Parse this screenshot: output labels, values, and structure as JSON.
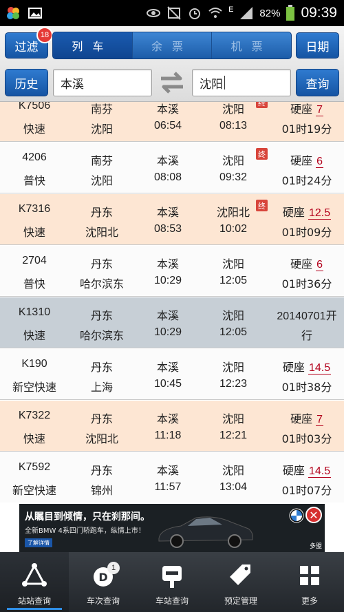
{
  "status_bar": {
    "network": "E",
    "battery": "82%",
    "time": "09:39"
  },
  "toolbar": {
    "filter_label": "过滤",
    "filter_badge": "18",
    "tabs": [
      {
        "label": "列车",
        "active": true
      },
      {
        "label": "余票",
        "active": false
      },
      {
        "label": "机票",
        "active": false
      }
    ],
    "date_label": "日期",
    "history_label": "历史",
    "from_value": "本溪",
    "to_value": "沈阳",
    "query_label": "查询"
  },
  "trains": [
    {
      "number": "K7506",
      "type": "快速",
      "origin": "南芬",
      "destination": "沈阳",
      "board": "本溪",
      "alight": "沈阳",
      "depart": "06:54",
      "arrive": "08:13",
      "terminal": "终",
      "seat": "硬座",
      "price": "7",
      "duration": "01时19分",
      "color": "orange"
    },
    {
      "number": "4206",
      "type": "普快",
      "origin": "南芬",
      "destination": "沈阳",
      "board": "本溪",
      "alight": "沈阳",
      "depart": "08:08",
      "arrive": "09:32",
      "terminal": "终",
      "seat": "硬座",
      "price": "6",
      "duration": "01时24分",
      "color": "white"
    },
    {
      "number": "K7316",
      "type": "快速",
      "origin": "丹东",
      "destination": "沈阳北",
      "board": "本溪",
      "alight": "沈阳北",
      "depart": "08:53",
      "arrive": "10:02",
      "terminal": "终",
      "seat": "硬座",
      "price": "12.5",
      "duration": "01时09分",
      "color": "orange"
    },
    {
      "number": "2704",
      "type": "普快",
      "origin": "丹东",
      "destination": "哈尔滨东",
      "board": "本溪",
      "alight": "沈阳",
      "depart": "10:29",
      "arrive": "12:05",
      "terminal": "",
      "seat": "硬座",
      "price": "6",
      "duration": "01时36分",
      "color": "white"
    },
    {
      "number": "K1310",
      "type": "快速",
      "origin": "丹东",
      "destination": "哈尔滨东",
      "board": "本溪",
      "alight": "沈阳",
      "depart": "10:29",
      "arrive": "12:05",
      "terminal": "",
      "open_date": "20140701开",
      "open_suffix": "行",
      "color": "gray"
    },
    {
      "number": "K190",
      "type": "新空快速",
      "origin": "丹东",
      "destination": "上海",
      "board": "本溪",
      "alight": "沈阳",
      "depart": "10:45",
      "arrive": "12:23",
      "terminal": "",
      "seat": "硬座",
      "price": "14.5",
      "duration": "01时38分",
      "color": "white"
    },
    {
      "number": "K7322",
      "type": "快速",
      "origin": "丹东",
      "destination": "沈阳北",
      "board": "本溪",
      "alight": "沈阳",
      "depart": "11:18",
      "arrive": "12:21",
      "terminal": "",
      "seat": "硬座",
      "price": "7",
      "duration": "01时03分",
      "color": "orange"
    },
    {
      "number": "K7592",
      "type": "新空快速",
      "origin": "丹东",
      "destination": "锦州",
      "board": "本溪",
      "alight": "沈阳",
      "depart": "11:57",
      "arrive": "13:04",
      "terminal": "",
      "seat": "硬座",
      "price": "14.5",
      "duration": "01时07分",
      "color": "white"
    }
  ],
  "ad": {
    "title": "从瞩目到倾情，只在刹那间。",
    "subtitle": "全新BMW 4系四门轿跑车，纵情上市！",
    "link": "了解详情",
    "brand": "多盟"
  },
  "bottom_nav": [
    {
      "label": "站站查询",
      "icon": "station-to-station-icon",
      "active": true
    },
    {
      "label": "车次查询",
      "icon": "train-number-icon",
      "badge": "1",
      "active": false
    },
    {
      "label": "车站查询",
      "icon": "station-sign-icon",
      "active": false
    },
    {
      "label": "预定管理",
      "icon": "tag-icon",
      "active": false
    },
    {
      "label": "更多",
      "icon": "grid-icon",
      "active": false
    }
  ]
}
